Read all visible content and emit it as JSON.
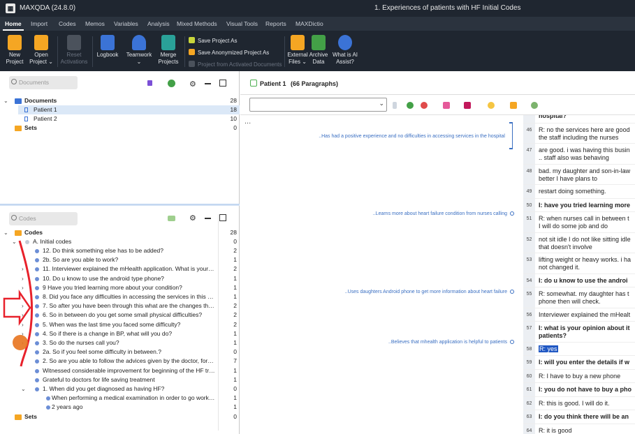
{
  "app": {
    "title": "MAXQDA (24.8.0)",
    "doc_window_title": "1. Experiences of patients with HF Initial Codes"
  },
  "tabs": [
    "Home",
    "Import",
    "Codes",
    "Memos",
    "Variables",
    "Analysis",
    "Mixed Methods",
    "Visual Tools",
    "Reports",
    "MAXDictio"
  ],
  "ribbon": {
    "new_project": [
      "New",
      "Project"
    ],
    "open_project": [
      "Open",
      "Project ⌄"
    ],
    "reset_activations": [
      "Reset",
      "Activations"
    ],
    "logbook": "Logbook",
    "teamwork": [
      "Teamwork",
      "⌄"
    ],
    "merge_projects": [
      "Merge",
      "Projects"
    ],
    "save_project_as": "Save Project As",
    "save_anonymized": "Save Anonymized Project As",
    "project_from_activated": "Project from Activated Documents",
    "external_files": [
      "External",
      "Files ⌄"
    ],
    "archive_data": [
      "Archive",
      "Data"
    ],
    "ai_assist": [
      "What is AI",
      "Assist?"
    ],
    "colors": {
      "orange": "#f5a623",
      "green": "#43a047",
      "blue": "#3b73d6",
      "purple": "#9c3fd6",
      "teal": "#2aa198"
    }
  },
  "documents_pane": {
    "search_placeholder": "Documents",
    "root": {
      "label": "Documents",
      "count": "28"
    },
    "items": [
      {
        "label": "Patient 1",
        "count": "18"
      },
      {
        "label": "Patient 2",
        "count": "10"
      }
    ],
    "sets": {
      "label": "Sets",
      "count": "0"
    }
  },
  "codes_pane": {
    "search_placeholder": "Codes",
    "root": {
      "label": "Codes",
      "count": "28"
    },
    "group": {
      "label": "A. Initial codes",
      "count": "0"
    },
    "items": [
      {
        "label": "12. Do think something else has to be added?",
        "count": "2"
      },
      {
        "label": "2b. So are you able to work?",
        "count": "1"
      },
      {
        "label": "11. Interviewer explained the mHealth application.  What is your opini...",
        "count": "2"
      },
      {
        "label": "10. Do u know to use the android type phone?",
        "count": "1"
      },
      {
        "label": "9 Have you tried learning more about your condition?",
        "count": "1"
      },
      {
        "label": "8. Did you face any difficulties in accessing the services in this hospital",
        "count": "1"
      },
      {
        "label": "7. So after you have been through this what are the changes that has ...",
        "count": "2"
      },
      {
        "label": "6. So in between do you get some small physical difficulties?",
        "count": "2"
      },
      {
        "label": "5.  When was the last time you faced some difficulty?",
        "count": "2"
      },
      {
        "label": "4. So if there is a change in BP, what will you do?",
        "count": "1"
      },
      {
        "label": "3. So do the nurses call you?",
        "count": "1"
      },
      {
        "label": "2a. So if you feel some difficulty in between.?",
        "count": "0"
      },
      {
        "label": "2. So are you able to follow the advices given by the doctor, for exam...",
        "count": "7"
      },
      {
        "label": "Witnessed considerable improvement for beginning of the HF treatm...",
        "count": "1"
      },
      {
        "label": "Grateful to doctors for life saving treatment",
        "count": "1"
      },
      {
        "label": "1. When did you get diagnosed as having HF?",
        "count": "0"
      },
      {
        "label": "When performing a medical examination in order to go work outs...",
        "count": "1"
      },
      {
        "label": "2 years ago",
        "count": "1"
      }
    ],
    "sets": {
      "label": "Sets",
      "count": "0"
    }
  },
  "document_browser": {
    "title": "Patient 1",
    "paragraphs_label": "(66 Paragraphs)",
    "dots": "...",
    "memos": [
      "..Has had a positive experience and no difficulties in accessing services in the hospital",
      "..Learns more about heart failure condition from nurses calling",
      "..Uses daughters Android phone to get more information about heart failure",
      "..Believes that mhealth application is helpful to patients"
    ],
    "paragraphs": [
      {
        "num": "",
        "lines": [
          "hospital?"
        ],
        "bold": true
      },
      {
        "num": "46",
        "lines": [
          "R: no the services here are good",
          "the staff including the nurses"
        ],
        "bold": false
      },
      {
        "num": "47",
        "lines": [
          "are good. i was having this busin",
          ".. staff also was behaving"
        ],
        "bold": false
      },
      {
        "num": "48",
        "lines": [
          "bad. my daughter and son-in-law",
          "better I have plans to"
        ],
        "bold": false
      },
      {
        "num": "49",
        "lines": [
          "restart doing something."
        ],
        "bold": false
      },
      {
        "num": "50",
        "lines": [
          "I: have you tried learning more"
        ],
        "bold": true
      },
      {
        "num": "51",
        "lines": [
          "R: when nurses call in between t",
          "I will do some job and do"
        ],
        "bold": false
      },
      {
        "num": "52",
        "lines": [
          "not sit idle I do not like sitting idle",
          "that doesn't involve"
        ],
        "bold": false
      },
      {
        "num": "53",
        "lines": [
          "lifting weight or heavy works. i ha",
          "not changed it."
        ],
        "bold": false
      },
      {
        "num": "54",
        "lines": [
          "I: do u know to use the androi"
        ],
        "bold": true
      },
      {
        "num": "55",
        "lines": [
          "R: somewhat. my daughter has t",
          "phone then will check."
        ],
        "bold": false
      },
      {
        "num": "56",
        "lines": [
          "Interviewer explained the mHealt"
        ],
        "bold": false
      },
      {
        "num": "57",
        "lines": [
          "I: what is your opinion about it",
          "patients?"
        ],
        "bold": true
      },
      {
        "num": "58",
        "lines": [
          "R: yes"
        ],
        "bold": false,
        "highlight": true
      },
      {
        "num": "59",
        "lines": [
          "I: will you enter the details if w"
        ],
        "bold": true
      },
      {
        "num": "60",
        "lines": [
          "R: I have to buy a new phone"
        ],
        "bold": false
      },
      {
        "num": "61",
        "lines": [
          "I: you do not have to buy a pho"
        ],
        "bold": true
      },
      {
        "num": "62",
        "lines": [
          "R: this is good. I will do it."
        ],
        "bold": false
      },
      {
        "num": "63",
        "lines": [
          "I: do you think there will be an"
        ],
        "bold": true
      },
      {
        "num": "64",
        "lines": [
          "R: it is good"
        ],
        "bold": false
      },
      {
        "num": "65",
        "lines": [
          "I: so if the phone is with daugh"
        ],
        "bold": true
      }
    ]
  }
}
